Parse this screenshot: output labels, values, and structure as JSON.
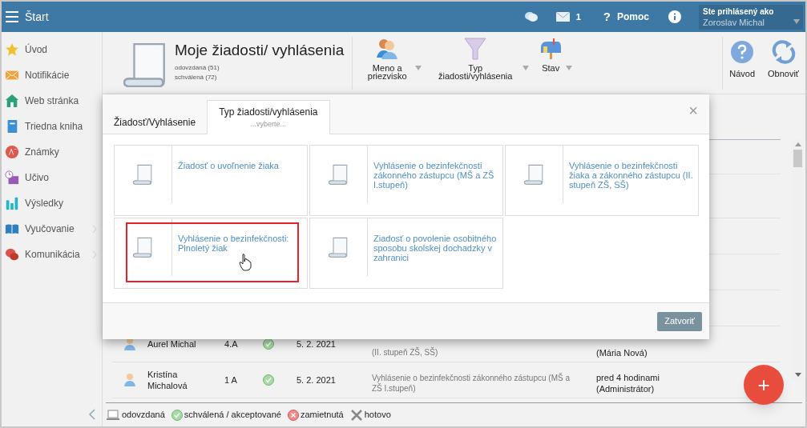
{
  "topbar": {
    "title": "Štart",
    "messages_count": "1",
    "help_mark": "?",
    "help": "Pomoc",
    "user_label": "Ste prihlásený ako",
    "user_name": "Zoroslav Michal"
  },
  "sidebar": {
    "items": [
      {
        "label": "Úvod",
        "has_children": false
      },
      {
        "label": "Notifikácie",
        "has_children": false
      },
      {
        "label": "Web stránka",
        "has_children": false
      },
      {
        "label": "Triedna kniha",
        "has_children": false
      },
      {
        "label": "Známky",
        "has_children": false
      },
      {
        "label": "Učivo",
        "has_children": false
      },
      {
        "label": "Výsledky",
        "has_children": false
      },
      {
        "label": "Vyučovanie",
        "has_children": true
      },
      {
        "label": "Komunikácia",
        "has_children": true
      }
    ]
  },
  "header": {
    "title": "Moje žiadosti/ vyhlásenia",
    "counts": [
      "odovzdaná (51)",
      "schválená (72)"
    ],
    "filters": [
      "Meno a priezvisko",
      "Typ žiadosti/vyhlásenia",
      "Stav"
    ],
    "actions": [
      "Návod",
      "Obnoviť"
    ]
  },
  "table": {
    "rows": [
      {
        "name": "Aurel Michal",
        "class": "4.A",
        "kind": "approved",
        "date": "5. 2. 2021",
        "description": "(II. stupeň ZŠ, SŠ)",
        "author": "(Mária Nová)"
      },
      {
        "name": "Kristína Michalová",
        "class": "1 A",
        "kind": "approved",
        "date": "5. 2. 2021",
        "description": "Vyhlásenie o bezinfekčnosti zákonného zástupcu (MŠ a ZŠ I.stupeň)",
        "author": "pred 4 hodinami (Administrátor)"
      }
    ]
  },
  "legend": [
    {
      "label": "odovzdaná",
      "kind": "submitted"
    },
    {
      "label": "schválená / akceptované",
      "kind": "approved"
    },
    {
      "label": "zamietnutá",
      "kind": "rejected"
    },
    {
      "label": "hotovo",
      "kind": "done"
    }
  ],
  "modal": {
    "tabs": [
      {
        "label": "Žiadosť/Vyhlásenie",
        "selected": false
      },
      {
        "label": "Typ žiadosti/vyhlásenia",
        "sublabel": "...vyberte...",
        "selected": true
      }
    ],
    "close": "×",
    "options": [
      {
        "label": "Žiadosť o uvoľnenie žiaka",
        "highlighted": false
      },
      {
        "label": "Vyhlásenie o bezinfekčnosti zákonného zástupcu (MŠ a ZŠ I.stupeň)",
        "highlighted": false
      },
      {
        "label": "Vyhlásenie o bezinfekčnosti žiaka a zákonného zástupcu (II. stupeň ZŠ, SŠ)",
        "highlighted": false
      },
      {
        "label": "Vyhlásenie o bezinfekčnosti: Plnoletý žiak",
        "highlighted": true
      },
      {
        "label": "Ziadosť o povolenie osobitného sposobu skolskej dochadzky v zahranici",
        "highlighted": false
      }
    ],
    "button": "Zatvoriť"
  },
  "fab": "+"
}
